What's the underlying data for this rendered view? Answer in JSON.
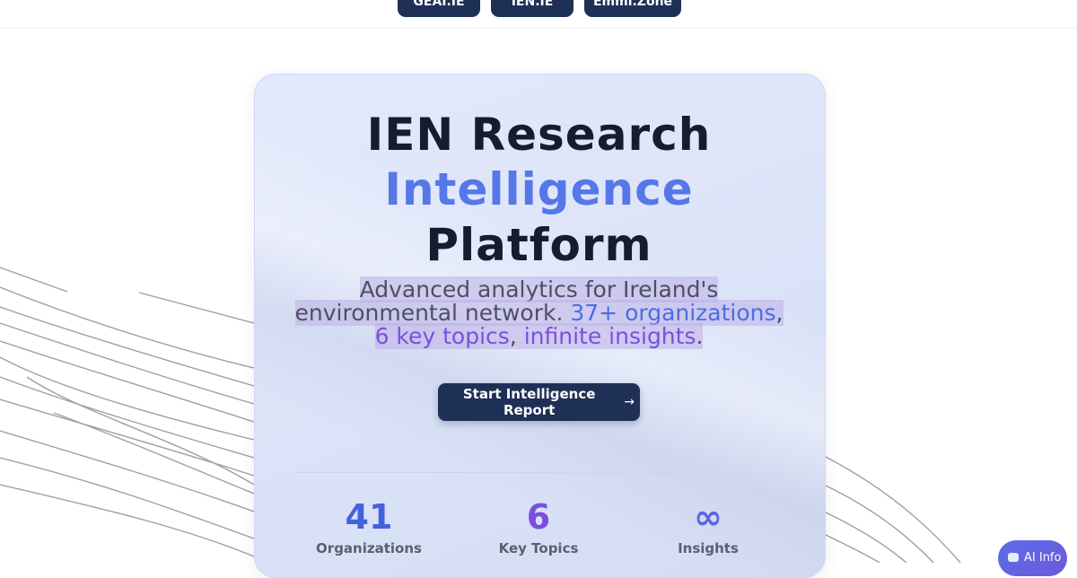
{
  "top_nav": {
    "tabs": [
      "GEAI.IE",
      "IEN.IE",
      "Emmi.Zone"
    ]
  },
  "hero": {
    "title_line1": "IEN Research",
    "title_line2": "Intelligence",
    "title_line3": "Platform",
    "subtitle_prefix": "Advanced analytics for Ireland's environmental network. ",
    "subtitle_orgs": "37+ organizations",
    "subtitle_sep1": ", ",
    "subtitle_topics": "6 key topics",
    "subtitle_sep2": ", ",
    "subtitle_insights": "infinite insights",
    "subtitle_end": ".",
    "cta_label": "Start Intelligence Report",
    "cta_icon": "arrow-right-icon"
  },
  "stats": [
    {
      "value": "41",
      "label": "Organizations"
    },
    {
      "value": "6",
      "label": "Key Topics"
    },
    {
      "value": "∞",
      "label": "Insights"
    }
  ],
  "ai_button": {
    "label": "AI Info",
    "icon": "robot-icon"
  },
  "colors": {
    "navy": "#1f3057",
    "accent_blue": "#5577e8",
    "accent_purple": "#7a4fe0"
  }
}
